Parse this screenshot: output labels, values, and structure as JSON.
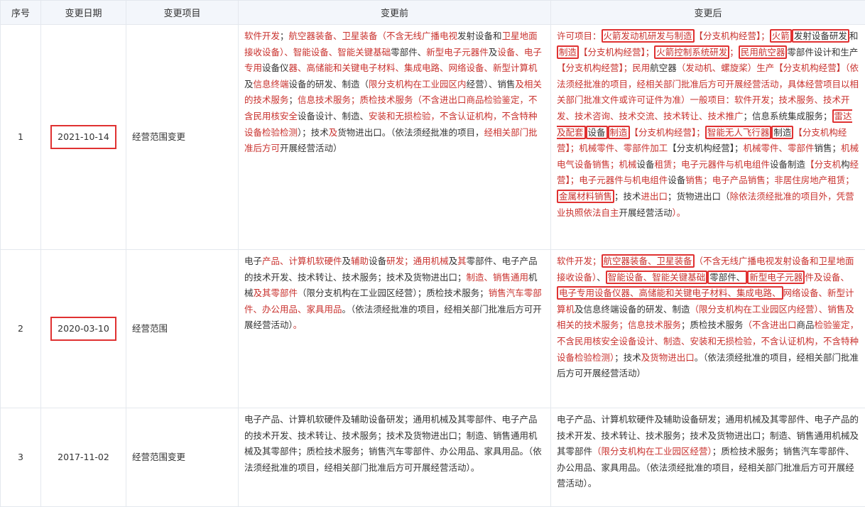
{
  "headers": [
    "序号",
    "变更日期",
    "变更项目",
    "变更前",
    "变更后"
  ],
  "rows": [
    {
      "index": "1",
      "date": "2021-10-14",
      "item": "经营范围变更",
      "before": [
        {
          "t": "软件开发",
          "s": "r"
        },
        {
          "t": "；"
        },
        {
          "t": "航空器装备、卫星装备（不含无线广播电视",
          "s": "r"
        },
        {
          "t": "发射设备和"
        },
        {
          "t": "卫星地面接收设备）、智能设备、智能关键基础",
          "s": "r"
        },
        {
          "t": "零部件、"
        },
        {
          "t": "新型电子元器件",
          "s": "r"
        },
        {
          "t": "及"
        },
        {
          "t": "设备、电子专用",
          "s": "r"
        },
        {
          "t": "设备仪"
        },
        {
          "t": "器、高储能和关键电子材料、集成电路、网络设备、新型计算机",
          "s": "r"
        },
        {
          "t": "及"
        },
        {
          "t": "信息终端",
          "s": "r"
        },
        {
          "t": "设备的研发、制造（"
        },
        {
          "t": "限分支机构在工业园区内",
          "s": "r"
        },
        {
          "t": "经营）、销售"
        },
        {
          "t": "及相关的技术服务",
          "s": "r"
        },
        {
          "t": "；"
        },
        {
          "t": "信息技术服务；质检技术服务（不含进出口商品检验鉴定，不含民用核安全",
          "s": "r"
        },
        {
          "t": "设备设计、制造、"
        },
        {
          "t": "安装和无损检验，不含认证机构，不含特种设备检验检测",
          "s": "r"
        },
        {
          "t": "）；技术"
        },
        {
          "t": "及",
          "s": "r"
        },
        {
          "t": "货物进出口。（依法须经批准的项目，"
        },
        {
          "t": "经相关部门批准后方可",
          "s": "r"
        },
        {
          "t": "开展经营活动）"
        }
      ],
      "after": [
        {
          "t": "许可项目：",
          "s": "r"
        },
        {
          "t": "火箭发动机研发与制造",
          "s": "rb"
        },
        {
          "t": "【分支机构经营】；",
          "s": "r"
        },
        {
          "t": "火箭",
          "s": "rb"
        },
        {
          "t": "发射设备研发",
          "s": "b"
        },
        {
          "t": "和"
        },
        {
          "t": "制造",
          "s": "rb"
        },
        {
          "t": "【分支机构经营】；",
          "s": "r"
        },
        {
          "t": "火箭控制系统研发",
          "s": "rb"
        },
        {
          "t": "；",
          "s": "r"
        },
        {
          "t": "民用航空器",
          "s": "rb"
        },
        {
          "t": "零部件设计和生产"
        },
        {
          "t": "【分支机构经营】；民用",
          "s": "r"
        },
        {
          "t": "航空器"
        },
        {
          "t": "（发动机、螺旋桨）生产【分支机构经营】",
          "s": "r"
        },
        {
          "t": "（依法须经批准的项目，经相关部门批准后方可开展经营活动，具体经营项目以相关部门批准文件或许可证件为准）",
          "s": "r"
        },
        {
          "t": "一般项目：软件开发；技术服务、技术开发、技术咨询、技术交流、技术转让、技术推广",
          "s": "r"
        },
        {
          "t": "；信息系统集成服务；"
        },
        {
          "t": "雷达及配套",
          "s": "rb"
        },
        {
          "t": "设备",
          "s": "b"
        },
        {
          "t": "制造",
          "s": "rb"
        },
        {
          "t": "【分支机构经营】；",
          "s": "r"
        },
        {
          "t": "智能无人飞行器",
          "s": "rb"
        },
        {
          "t": "制造",
          "s": "b"
        },
        {
          "t": "【分支机构经营】；机械零件、零部件加工",
          "s": "r"
        },
        {
          "t": "【分支机构经营】；"
        },
        {
          "t": "机械零件、零部件",
          "s": "r"
        },
        {
          "t": "销售；"
        },
        {
          "t": "机械电气设备销售；机械",
          "s": "r"
        },
        {
          "t": "设备"
        },
        {
          "t": "租赁；电子元器件与机电组件",
          "s": "r"
        },
        {
          "t": "设备制造"
        },
        {
          "t": "【分支机",
          "s": "r"
        },
        {
          "t": "构"
        },
        {
          "t": "经营】；电子元器件与机电组件",
          "s": "r"
        },
        {
          "t": "设备"
        },
        {
          "t": "销售；电子产品销售；非居住房地产租赁；",
          "s": "r"
        },
        {
          "t": "金属材料销售",
          "s": "rb"
        },
        {
          "t": "；技术"
        },
        {
          "t": "进出口",
          "s": "r"
        },
        {
          "t": "；货物进出口（"
        },
        {
          "t": "除依法须经批准的项目外，凭营业执照依法自主",
          "s": "r"
        },
        {
          "t": "开展经营活动"
        },
        {
          "t": "）。",
          "s": "r"
        }
      ]
    },
    {
      "index": "2",
      "date": "2020-03-10",
      "item": "经营范围",
      "before": [
        {
          "t": "电子"
        },
        {
          "t": "产品、计算机软硬件",
          "s": "r"
        },
        {
          "t": "及"
        },
        {
          "t": "辅助",
          "s": "r"
        },
        {
          "t": "设备"
        },
        {
          "t": "研发；通用机械",
          "s": "r"
        },
        {
          "t": "及"
        },
        {
          "t": "其",
          "s": "r"
        },
        {
          "t": "零部件、电子产品的技术开发、技术转让、技术服务；技术及货物进出口；"
        },
        {
          "t": "制造、销售通用",
          "s": "r"
        },
        {
          "t": "机械"
        },
        {
          "t": "及其零部件",
          "s": "r"
        },
        {
          "t": "（限分支机构在工业园区经营）；质检技术服务；"
        },
        {
          "t": "销售汽车零部件、办公用品、家具用品",
          "s": "r"
        },
        {
          "t": "。（依法须经批准的项目，经相关部门批准后方可开展经营活动）"
        },
        {
          "t": "。",
          "s": "r"
        }
      ],
      "after": [
        {
          "t": "软件开发；",
          "s": "r"
        },
        {
          "t": "航空器装备、卫星装备",
          "s": "rb"
        },
        {
          "t": "（不含无线广播电视发射设备和卫星地面接收设备）",
          "s": "r"
        },
        {
          "t": "、"
        },
        {
          "t": "智能设备、智能关键基础",
          "s": "rb"
        },
        {
          "t": "零部件、",
          "s": "b"
        },
        {
          "t": "新型电子元器",
          "s": "rb"
        },
        {
          "t": "件及设备、",
          "s": "r"
        },
        {
          "t": "电子专用设备仪器、高储能和关键电子材料、集成电路、",
          "s": "rb"
        },
        {
          "t": "网络设备、新型计算机",
          "s": "r"
        },
        {
          "t": "及信息终端设备的研发、制造"
        },
        {
          "t": "（限分支机构在工业园区",
          "s": "r"
        },
        {
          "t": "内经营）、销售及相关的技术服务；信息技术服务",
          "s": "r"
        },
        {
          "t": "；质检技术服务"
        },
        {
          "t": "（不含进出口",
          "s": "r"
        },
        {
          "t": "商品"
        },
        {
          "t": "检验鉴定，不含民用核安全设备设计、制造、安装和无损检验，不含认证机构，不含特种设备检验检测）",
          "s": "r"
        },
        {
          "t": "；技术"
        },
        {
          "t": "及货物进出口",
          "s": "r"
        },
        {
          "t": "。（依法须经批准的项目，经相关部门批准后方可开展经营活动）"
        }
      ]
    },
    {
      "index": "3",
      "date": "2017-11-02",
      "item": "经营范围变更",
      "before": [
        {
          "t": "电子产品、计算机软硬件及辅助设备研发；通用机械及其零部件、电子产品的技术开发、技术转让、技术服务；技术及货物进出口；制造、销售通用机械及其零部件；质检技术服务；销售汽车零部件、办公用品、家具用品。（依法须经批准的项目，经相关部门批准后方可开展经营活动）。"
        }
      ],
      "after": [
        {
          "t": "电子产品、计算机软硬件及辅助设备研发；通用机械及其零部件、电子产品的技术开发、技术转让、技术服务；技术及货物进出口；制造、销售通用机械及其零部件"
        },
        {
          "t": "（限分支机构在工业园区经营）",
          "s": "r"
        },
        {
          "t": "；质检技术服务；销售汽车零部件、办公用品、家具用品。（依法须经批准的项目，经相关部门批准后方可开展经营活动）。"
        }
      ]
    }
  ]
}
